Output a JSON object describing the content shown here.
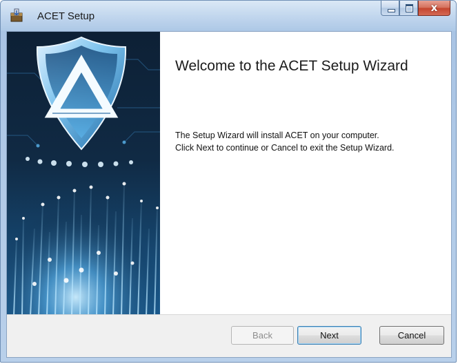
{
  "window": {
    "title": "ACET Setup",
    "app_icon": "installer-box-icon",
    "caption_buttons": {
      "minimize_icon": "minimize-icon",
      "maximize_icon": "maximize-icon",
      "close_icon": "close-icon",
      "close_glyph": "x"
    }
  },
  "banner": {
    "image": "shield-with-triangle-logo over fiber-optic light background",
    "logo_icon": "shield-logo-icon"
  },
  "content": {
    "heading": "Welcome to the ACET Setup Wizard",
    "body_line_1": "The Setup Wizard will install ACET on your computer.",
    "body_line_2": "Click Next to continue or Cancel to exit the Setup Wizard."
  },
  "footer": {
    "back_label": "Back",
    "back_enabled": false,
    "next_label": "Next",
    "next_default": true,
    "cancel_label": "Cancel"
  },
  "colors": {
    "titlebar": "#c2d7ee",
    "close_button": "#c4442d",
    "banner_bg": "#0a1a2e",
    "footer_bg": "#f0f0f0"
  }
}
